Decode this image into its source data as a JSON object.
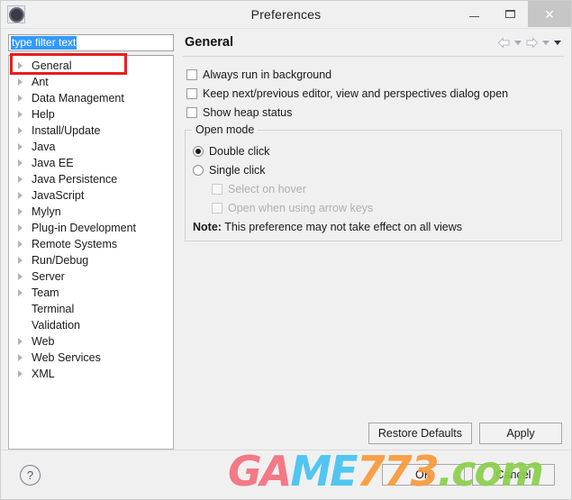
{
  "window": {
    "title": "Preferences",
    "app_icon": "eclipse-gear-icon",
    "controls": {
      "minimize": "minimize-icon",
      "maximize": "maximize-icon",
      "close": "close-icon"
    }
  },
  "sidebar": {
    "filter": {
      "value": "type filter text",
      "placeholder": "type filter text",
      "selected": true
    },
    "items": [
      {
        "label": "General",
        "expandable": true,
        "selected": true
      },
      {
        "label": "Ant",
        "expandable": true,
        "selected": false
      },
      {
        "label": "Data Management",
        "expandable": true,
        "selected": false
      },
      {
        "label": "Help",
        "expandable": true,
        "selected": false
      },
      {
        "label": "Install/Update",
        "expandable": true,
        "selected": false
      },
      {
        "label": "Java",
        "expandable": true,
        "selected": false
      },
      {
        "label": "Java EE",
        "expandable": true,
        "selected": false
      },
      {
        "label": "Java Persistence",
        "expandable": true,
        "selected": false
      },
      {
        "label": "JavaScript",
        "expandable": true,
        "selected": false
      },
      {
        "label": "Mylyn",
        "expandable": true,
        "selected": false
      },
      {
        "label": "Plug-in Development",
        "expandable": true,
        "selected": false
      },
      {
        "label": "Remote Systems",
        "expandable": true,
        "selected": false
      },
      {
        "label": "Run/Debug",
        "expandable": true,
        "selected": false
      },
      {
        "label": "Server",
        "expandable": true,
        "selected": false
      },
      {
        "label": "Team",
        "expandable": true,
        "selected": false
      },
      {
        "label": "Terminal",
        "expandable": false,
        "selected": false
      },
      {
        "label": "Validation",
        "expandable": false,
        "selected": false
      },
      {
        "label": "Web",
        "expandable": true,
        "selected": false
      },
      {
        "label": "Web Services",
        "expandable": true,
        "selected": false
      },
      {
        "label": "XML",
        "expandable": true,
        "selected": false
      }
    ]
  },
  "page": {
    "title": "General",
    "nav": {
      "back": "back-arrow-icon",
      "back_menu": "chevron-down-icon",
      "forward": "forward-arrow-icon",
      "forward_menu": "chevron-down-icon",
      "menu": "chevron-down-icon"
    },
    "checkboxes": [
      {
        "label": "Always run in background",
        "checked": false,
        "enabled": true
      },
      {
        "label": "Keep next/previous editor, view and perspectives dialog open",
        "checked": false,
        "enabled": true
      },
      {
        "label": "Show heap status",
        "checked": false,
        "enabled": true
      }
    ],
    "open_mode": {
      "group_label": "Open mode",
      "radios": [
        {
          "label": "Double click",
          "checked": true
        },
        {
          "label": "Single click",
          "checked": false
        }
      ],
      "sub_checkboxes": [
        {
          "label": "Select on hover",
          "checked": false,
          "enabled": false
        },
        {
          "label": "Open when using arrow keys",
          "checked": false,
          "enabled": false
        }
      ],
      "note_prefix": "Note:",
      "note_text": "This preference may not take effect on all views"
    },
    "actions": {
      "restore_defaults": "Restore Defaults",
      "apply": "Apply"
    }
  },
  "footer": {
    "help": "?",
    "ok": "OK",
    "cancel": "Cancel"
  },
  "watermark": {
    "part1": "GA",
    "part2": "ME",
    "part3": "773",
    "part4": ".com"
  },
  "colors": {
    "annotation": "#e81d1d",
    "selection": "#3399ff",
    "dialog_bg": "#f0f0f0"
  }
}
